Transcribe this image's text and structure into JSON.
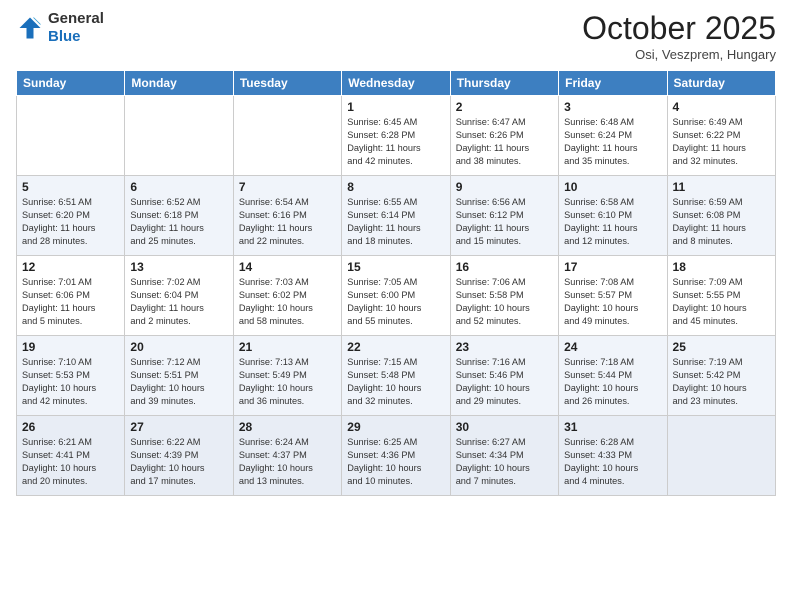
{
  "header": {
    "logo": {
      "general": "General",
      "blue": "Blue"
    },
    "title": "October 2025",
    "subtitle": "Osi, Veszprem, Hungary"
  },
  "days_of_week": [
    "Sunday",
    "Monday",
    "Tuesday",
    "Wednesday",
    "Thursday",
    "Friday",
    "Saturday"
  ],
  "weeks": [
    [
      {
        "day": "",
        "info": ""
      },
      {
        "day": "",
        "info": ""
      },
      {
        "day": "",
        "info": ""
      },
      {
        "day": "1",
        "info": "Sunrise: 6:45 AM\nSunset: 6:28 PM\nDaylight: 11 hours\nand 42 minutes."
      },
      {
        "day": "2",
        "info": "Sunrise: 6:47 AM\nSunset: 6:26 PM\nDaylight: 11 hours\nand 38 minutes."
      },
      {
        "day": "3",
        "info": "Sunrise: 6:48 AM\nSunset: 6:24 PM\nDaylight: 11 hours\nand 35 minutes."
      },
      {
        "day": "4",
        "info": "Sunrise: 6:49 AM\nSunset: 6:22 PM\nDaylight: 11 hours\nand 32 minutes."
      }
    ],
    [
      {
        "day": "5",
        "info": "Sunrise: 6:51 AM\nSunset: 6:20 PM\nDaylight: 11 hours\nand 28 minutes."
      },
      {
        "day": "6",
        "info": "Sunrise: 6:52 AM\nSunset: 6:18 PM\nDaylight: 11 hours\nand 25 minutes."
      },
      {
        "day": "7",
        "info": "Sunrise: 6:54 AM\nSunset: 6:16 PM\nDaylight: 11 hours\nand 22 minutes."
      },
      {
        "day": "8",
        "info": "Sunrise: 6:55 AM\nSunset: 6:14 PM\nDaylight: 11 hours\nand 18 minutes."
      },
      {
        "day": "9",
        "info": "Sunrise: 6:56 AM\nSunset: 6:12 PM\nDaylight: 11 hours\nand 15 minutes."
      },
      {
        "day": "10",
        "info": "Sunrise: 6:58 AM\nSunset: 6:10 PM\nDaylight: 11 hours\nand 12 minutes."
      },
      {
        "day": "11",
        "info": "Sunrise: 6:59 AM\nSunset: 6:08 PM\nDaylight: 11 hours\nand 8 minutes."
      }
    ],
    [
      {
        "day": "12",
        "info": "Sunrise: 7:01 AM\nSunset: 6:06 PM\nDaylight: 11 hours\nand 5 minutes."
      },
      {
        "day": "13",
        "info": "Sunrise: 7:02 AM\nSunset: 6:04 PM\nDaylight: 11 hours\nand 2 minutes."
      },
      {
        "day": "14",
        "info": "Sunrise: 7:03 AM\nSunset: 6:02 PM\nDaylight: 10 hours\nand 58 minutes."
      },
      {
        "day": "15",
        "info": "Sunrise: 7:05 AM\nSunset: 6:00 PM\nDaylight: 10 hours\nand 55 minutes."
      },
      {
        "day": "16",
        "info": "Sunrise: 7:06 AM\nSunset: 5:58 PM\nDaylight: 10 hours\nand 52 minutes."
      },
      {
        "day": "17",
        "info": "Sunrise: 7:08 AM\nSunset: 5:57 PM\nDaylight: 10 hours\nand 49 minutes."
      },
      {
        "day": "18",
        "info": "Sunrise: 7:09 AM\nSunset: 5:55 PM\nDaylight: 10 hours\nand 45 minutes."
      }
    ],
    [
      {
        "day": "19",
        "info": "Sunrise: 7:10 AM\nSunset: 5:53 PM\nDaylight: 10 hours\nand 42 minutes."
      },
      {
        "day": "20",
        "info": "Sunrise: 7:12 AM\nSunset: 5:51 PM\nDaylight: 10 hours\nand 39 minutes."
      },
      {
        "day": "21",
        "info": "Sunrise: 7:13 AM\nSunset: 5:49 PM\nDaylight: 10 hours\nand 36 minutes."
      },
      {
        "day": "22",
        "info": "Sunrise: 7:15 AM\nSunset: 5:48 PM\nDaylight: 10 hours\nand 32 minutes."
      },
      {
        "day": "23",
        "info": "Sunrise: 7:16 AM\nSunset: 5:46 PM\nDaylight: 10 hours\nand 29 minutes."
      },
      {
        "day": "24",
        "info": "Sunrise: 7:18 AM\nSunset: 5:44 PM\nDaylight: 10 hours\nand 26 minutes."
      },
      {
        "day": "25",
        "info": "Sunrise: 7:19 AM\nSunset: 5:42 PM\nDaylight: 10 hours\nand 23 minutes."
      }
    ],
    [
      {
        "day": "26",
        "info": "Sunrise: 6:21 AM\nSunset: 4:41 PM\nDaylight: 10 hours\nand 20 minutes."
      },
      {
        "day": "27",
        "info": "Sunrise: 6:22 AM\nSunset: 4:39 PM\nDaylight: 10 hours\nand 17 minutes."
      },
      {
        "day": "28",
        "info": "Sunrise: 6:24 AM\nSunset: 4:37 PM\nDaylight: 10 hours\nand 13 minutes."
      },
      {
        "day": "29",
        "info": "Sunrise: 6:25 AM\nSunset: 4:36 PM\nDaylight: 10 hours\nand 10 minutes."
      },
      {
        "day": "30",
        "info": "Sunrise: 6:27 AM\nSunset: 4:34 PM\nDaylight: 10 hours\nand 7 minutes."
      },
      {
        "day": "31",
        "info": "Sunrise: 6:28 AM\nSunset: 4:33 PM\nDaylight: 10 hours\nand 4 minutes."
      },
      {
        "day": "",
        "info": ""
      }
    ]
  ]
}
